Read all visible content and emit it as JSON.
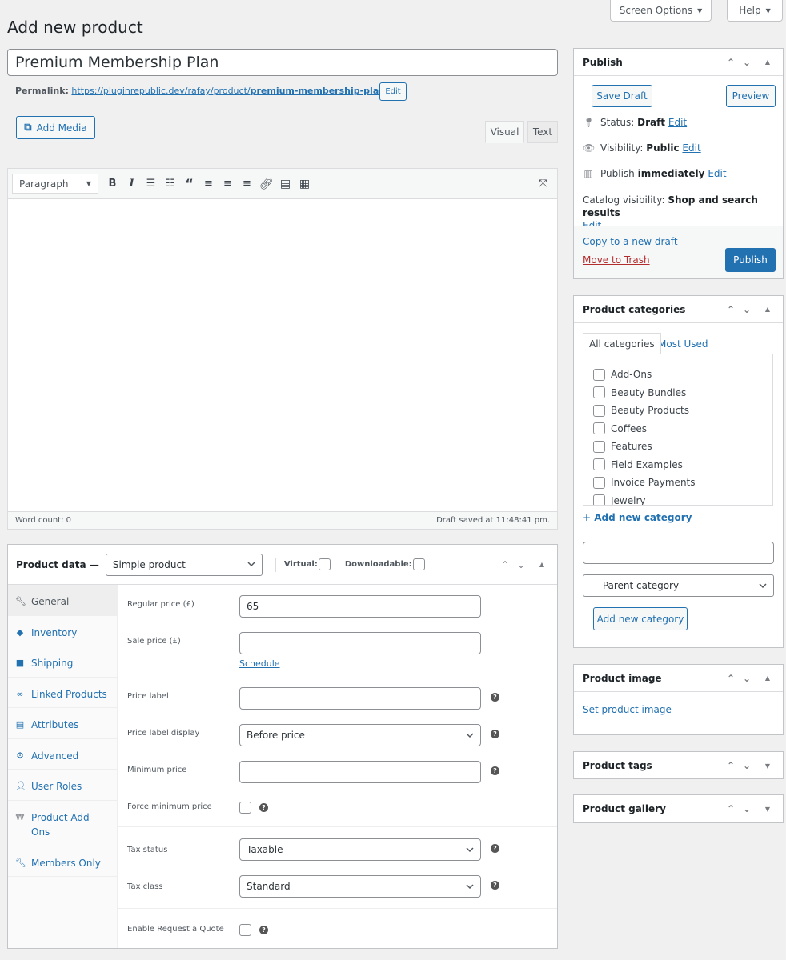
{
  "top": {
    "screen_options": "Screen Options",
    "help": "Help"
  },
  "page": {
    "title": "Add new product"
  },
  "product_title": "Premium Membership Plan",
  "permalink": {
    "label": "Permalink:",
    "base_url": "https://pluginrepublic.dev/rafay/product/",
    "slug": "premium-membership-plan/",
    "edit_label": "Edit"
  },
  "editor": {
    "add_media": "Add Media",
    "tabs": {
      "visual": "Visual",
      "text": "Text"
    },
    "format": "Paragraph",
    "toolbar_icons": [
      "bold-icon",
      "italic-icon",
      "bulleted-list-icon",
      "numbered-list-icon",
      "blockquote-icon",
      "align-left-icon",
      "align-center-icon",
      "align-right-icon",
      "link-icon",
      "read-more-icon",
      "toolbar-toggle-icon"
    ],
    "word_count": "Word count: 0",
    "draft_saved": "Draft saved at 11:48:41 pm."
  },
  "product_data": {
    "label": "Product data —",
    "type": "Simple product",
    "virtual_label": "Virtual:",
    "downloadable_label": "Downloadable:",
    "tabs": [
      {
        "label": "General",
        "icon": "wrench-icon"
      },
      {
        "label": "Inventory",
        "icon": "tag-icon"
      },
      {
        "label": "Shipping",
        "icon": "truck-icon"
      },
      {
        "label": "Linked Products",
        "icon": "link-icon"
      },
      {
        "label": "Attributes",
        "icon": "list-table-icon"
      },
      {
        "label": "Advanced",
        "icon": "gear-icon"
      },
      {
        "label": "User Roles",
        "icon": "user-icon"
      },
      {
        "label": "Product Add-Ons",
        "icon": "addons-icon"
      },
      {
        "label": "Members Only",
        "icon": "wrench-icon"
      }
    ],
    "fields": {
      "regular_price_label": "Regular price (£)",
      "regular_price_value": "65",
      "sale_price_label": "Sale price (£)",
      "sale_price_value": "",
      "schedule_link": "Schedule",
      "price_label_label": "Price label",
      "price_label_value": "",
      "price_label_display_label": "Price label display",
      "price_label_display_value": "Before price",
      "minimum_price_label": "Minimum price",
      "minimum_price_value": "",
      "force_minimum_label": "Force minimum price",
      "tax_status_label": "Tax status",
      "tax_status_value": "Taxable",
      "tax_class_label": "Tax class",
      "tax_class_value": "Standard",
      "request_quote_label": "Enable Request a Quote"
    }
  },
  "publish": {
    "title": "Publish",
    "save_draft": "Save Draft",
    "preview": "Preview",
    "status_label": "Status:",
    "status_value": "Draft",
    "visibility_label": "Visibility:",
    "visibility_value": "Public",
    "publish_label": "Publish",
    "publish_value": "immediately",
    "edit": "Edit",
    "catalog_label": "Catalog visibility:",
    "catalog_value": "Shop and search results",
    "copy_draft": "Copy to a new draft",
    "trash": "Move to Trash",
    "publish_button": "Publish"
  },
  "categories": {
    "title": "Product categories",
    "tab_all": "All categories",
    "tab_most_used": "Most Used",
    "items": [
      "Add-Ons",
      "Beauty Bundles",
      "Beauty Products",
      "Coffees",
      "Features",
      "Field Examples",
      "Invoice Payments",
      "Jewelry"
    ],
    "add_link": "+ Add new category",
    "new_name_value": "",
    "parent_select": "— Parent category —",
    "add_button": "Add new category"
  },
  "product_image": {
    "title": "Product image",
    "set_link": "Set product image"
  },
  "product_tags": {
    "title": "Product tags"
  },
  "product_gallery": {
    "title": "Product gallery"
  },
  "colors": {
    "accent": "#2271b1",
    "trash": "#b32d2e",
    "background": "#f0f0f1"
  }
}
